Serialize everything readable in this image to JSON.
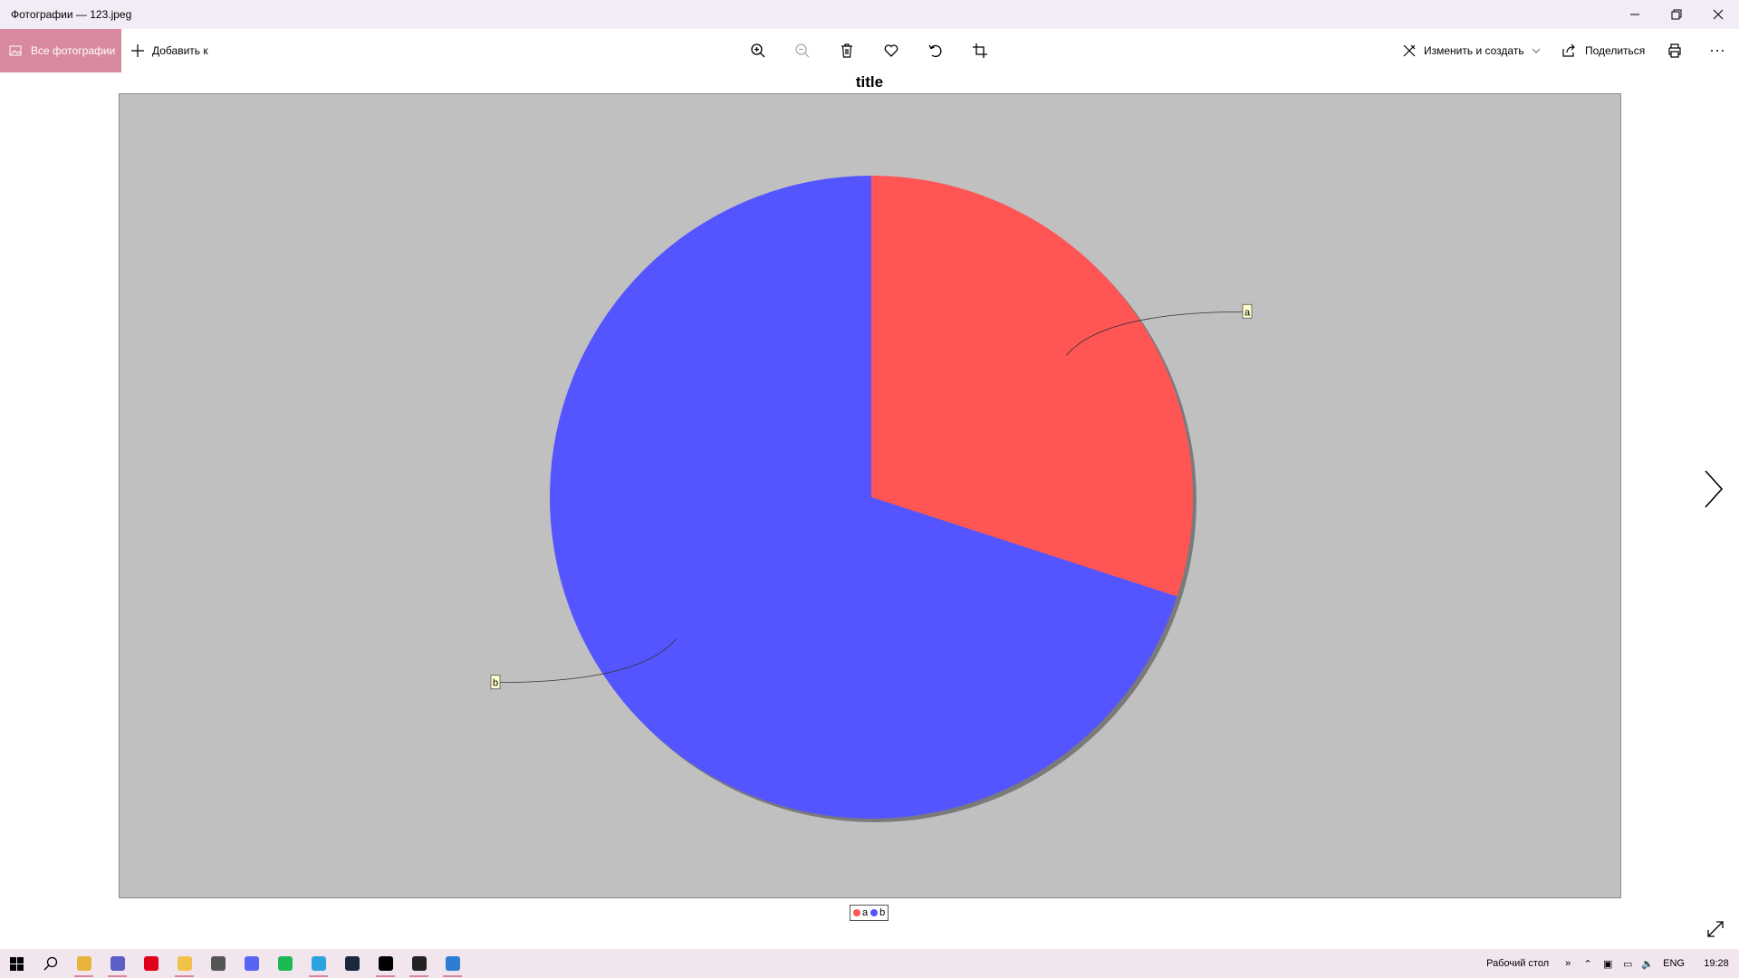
{
  "window": {
    "title": "Фотографии — 123.jpeg"
  },
  "toolbar": {
    "all_photos_label": "Все фотографии",
    "add_to_label": "Добавить к",
    "edit_create_label": "Изменить и создать",
    "share_label": "Поделиться",
    "accent_color": "#d9899f"
  },
  "chart_data": {
    "type": "pie",
    "title": "title",
    "categories": [
      "a",
      "b"
    ],
    "values": [
      30,
      70
    ],
    "colors": [
      "#ff5555",
      "#5555ff"
    ],
    "background": "#c0c0c0",
    "legend": "bottom-center",
    "labels": [
      {
        "text": "a"
      },
      {
        "text": "b"
      }
    ]
  },
  "taskbar": {
    "apps": [
      {
        "name": "chrome",
        "color": "#e8b33a",
        "running": true
      },
      {
        "name": "teams",
        "color": "#5b5fc7",
        "running": true
      },
      {
        "name": "opera",
        "color": "#e0001b",
        "running": false
      },
      {
        "name": "explorer",
        "color": "#f0c24a",
        "running": true
      },
      {
        "name": "calculator",
        "color": "#555555",
        "running": false
      },
      {
        "name": "discord",
        "color": "#5865f2",
        "running": false
      },
      {
        "name": "spotify",
        "color": "#1db954",
        "running": false
      },
      {
        "name": "telegram",
        "color": "#2aa3df",
        "running": true
      },
      {
        "name": "steam",
        "color": "#1b2838",
        "running": false
      },
      {
        "name": "intellij",
        "color": "#000000",
        "running": true
      },
      {
        "name": "terminal",
        "color": "#222222",
        "running": true
      },
      {
        "name": "photos",
        "color": "#2d7dd2",
        "running": true
      }
    ],
    "desktop_label": "Рабочий стол",
    "language": "ENG",
    "time": "19:28"
  }
}
